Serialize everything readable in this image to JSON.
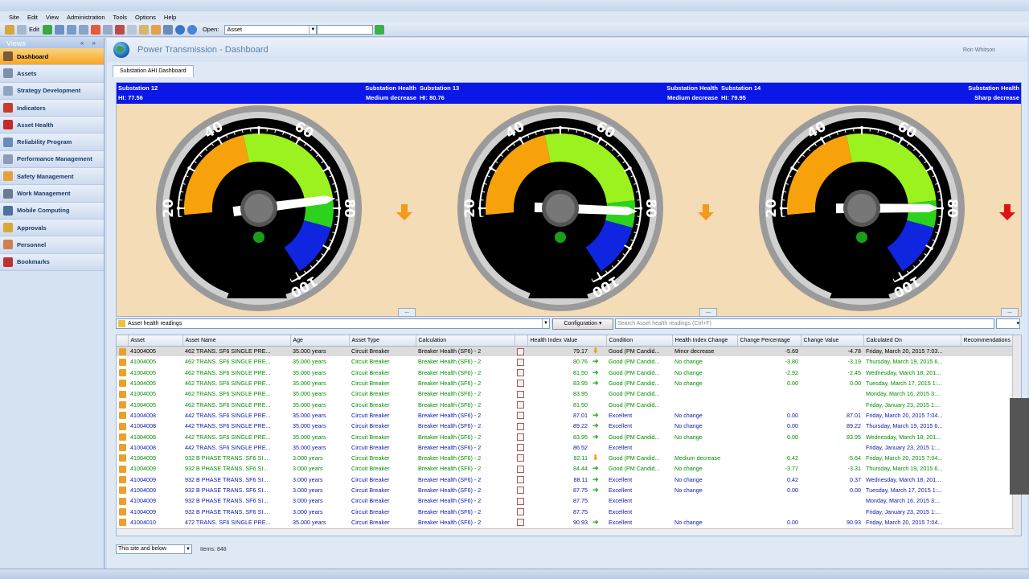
{
  "menu": [
    "Site",
    "Edit",
    "View",
    "Administration",
    "Tools",
    "Options",
    "Help"
  ],
  "toolbar": {
    "edit_label": "Edit",
    "open_label": "Open:",
    "open_value": "Asset"
  },
  "sidebar": {
    "header": "Views",
    "controls": "« »",
    "items": [
      {
        "label": "Dashboard",
        "icon": "dashboard-icon",
        "color": "#7a5a3a"
      },
      {
        "label": "Assets",
        "icon": "assets-icon",
        "color": "#7c8fa8"
      },
      {
        "label": "Strategy Development",
        "icon": "strategy-icon",
        "color": "#8ea6c4"
      },
      {
        "label": "Indicators",
        "icon": "indicators-icon",
        "color": "#c83b2a"
      },
      {
        "label": "Asset Health",
        "icon": "asset-health-icon",
        "color": "#c42a2a"
      },
      {
        "label": "Reliability Program",
        "icon": "reliability-icon",
        "color": "#6a8bb8"
      },
      {
        "label": "Performance Management",
        "icon": "performance-icon",
        "color": "#8a9cb6"
      },
      {
        "label": "Safety Management",
        "icon": "safety-icon",
        "color": "#e8a13a"
      },
      {
        "label": "Work Management",
        "icon": "work-icon",
        "color": "#6c7c90"
      },
      {
        "label": "Mobile Computing",
        "icon": "mobile-icon",
        "color": "#4f6f9f"
      },
      {
        "label": "Approvals",
        "icon": "approvals-icon",
        "color": "#d8a83a"
      },
      {
        "label": "Personnel",
        "icon": "personnel-icon",
        "color": "#d08050"
      },
      {
        "label": "Bookmarks",
        "icon": "bookmarks-icon",
        "color": "#c03030"
      }
    ]
  },
  "header": {
    "title": "Power Transmission - Dashboard",
    "user": "Ron Whitson"
  },
  "tab": {
    "label": "Substation AHI Dashboard"
  },
  "gauges": [
    {
      "name": "Substation 12",
      "hi": "HI: 77.56",
      "status_label": "Substation Health",
      "status": "Medium decrease",
      "value": 77.56,
      "trend_color": "#f29a1c",
      "trend": "down"
    },
    {
      "name": "Substation 13",
      "hi": "HI: 80.76",
      "status_label": "Substation Health",
      "status": "Medium decrease",
      "value": 80.76,
      "trend_color": "#f29a1c",
      "trend": "down"
    },
    {
      "name": "Substation 14",
      "hi": "HI: 79.95",
      "status_label": "Substation Health",
      "status": "Sharp decrease",
      "value": 79.95,
      "trend_color": "#e0101a",
      "trend": "down"
    }
  ],
  "gauge_ticks": [
    "20",
    "40",
    "60",
    "80",
    "100"
  ],
  "ellipsis": "...",
  "grid_toolbar": {
    "source": "Asset health readings",
    "config": "Configuration",
    "search_placeholder": "Search Asset health readings  (Ctrl+F)"
  },
  "columns": [
    "Asset",
    "Asset Name",
    "Age",
    "Asset Type",
    "Calculation",
    "",
    "Health Index Value",
    "Condition",
    "Health Index Change",
    "Change Percentage",
    "Change Value",
    "Calculated On",
    "Recommendations"
  ],
  "rows": [
    {
      "style": "selected",
      "asset": "41004005",
      "name": "462 TRANS. SF6 SINGLE PRE...",
      "age": "35.000 years",
      "type": "Circuit Breaker",
      "calc": "Breaker Health (SF6) - 2",
      "hiv": "79.17",
      "trend": "down-orange",
      "cond": "Good (PM Candid...",
      "change": "Minor decrease",
      "pct": "-5.69",
      "val": "-4.78",
      "on": "Friday, March 20, 2015 7:03..."
    },
    {
      "style": "g",
      "asset": "41004005",
      "name": "462 TRANS. SF6 SINGLE PRE...",
      "age": "35.000 years",
      "type": "Circuit Breaker",
      "calc": "Breaker Health (SF6) - 2",
      "hiv": "80.76",
      "trend": "right",
      "cond": "Good (PM Candid...",
      "change": "No change",
      "pct": "-3.80",
      "val": "-3.19",
      "on": "Thursday, March 19, 2015 6..."
    },
    {
      "style": "g",
      "asset": "41004005",
      "name": "462 TRANS. SF6 SINGLE PRE...",
      "age": "35.000 years",
      "type": "Circuit Breaker",
      "calc": "Breaker Health (SF6) - 2",
      "hiv": "81.50",
      "trend": "right",
      "cond": "Good (PM Candid...",
      "change": "No change",
      "pct": "-2.92",
      "val": "-2.45",
      "on": "Wednesday, March 18, 201..."
    },
    {
      "style": "g",
      "asset": "41004005",
      "name": "462 TRANS. SF6 SINGLE PRE...",
      "age": "35.000 years",
      "type": "Circuit Breaker",
      "calc": "Breaker Health (SF6) - 2",
      "hiv": "83.95",
      "trend": "right",
      "cond": "Good (PM Candid...",
      "change": "No change",
      "pct": "0.00",
      "val": "0.00",
      "on": "Tuesday, March 17, 2015 1:..."
    },
    {
      "style": "g",
      "asset": "41004005",
      "name": "462 TRANS. SF6 SINGLE PRE...",
      "age": "35.000 years",
      "type": "Circuit Breaker",
      "calc": "Breaker Health (SF6) - 2",
      "hiv": "83.95",
      "trend": "",
      "cond": "Good (PM Candid...",
      "change": "",
      "pct": "",
      "val": "",
      "on": "Monday, March 16, 2015 3:..."
    },
    {
      "style": "g",
      "asset": "41004005",
      "name": "462 TRANS. SF6 SINGLE PRE...",
      "age": "35.000 years",
      "type": "Circuit Breaker",
      "calc": "Breaker Health (SF6) - 2",
      "hiv": "81.50",
      "trend": "",
      "cond": "Good (PM Candid...",
      "change": "",
      "pct": "",
      "val": "",
      "on": "Friday, January 23, 2015 1:..."
    },
    {
      "style": "b",
      "asset": "41004008",
      "name": "442 TRANS. SF6 SINGLE PRE...",
      "age": "35.000 years",
      "type": "Circuit Breaker",
      "calc": "Breaker Health (SF6) - 2",
      "hiv": "87.01",
      "trend": "right",
      "cond": "Excellent",
      "change": "No change",
      "pct": "0.00",
      "val": "87.01",
      "on": "Friday, March 20, 2015 7:04..."
    },
    {
      "style": "b",
      "asset": "41004008",
      "name": "442 TRANS. SF6 SINGLE PRE...",
      "age": "35.000 years",
      "type": "Circuit Breaker",
      "calc": "Breaker Health (SF6) - 2",
      "hiv": "89.22",
      "trend": "right",
      "cond": "Excellent",
      "change": "No change",
      "pct": "0.00",
      "val": "89.22",
      "on": "Thursday, March 19, 2015 6..."
    },
    {
      "style": "g",
      "asset": "41004008",
      "name": "442 TRANS. SF6 SINGLE PRE...",
      "age": "35.000 years",
      "type": "Circuit Breaker",
      "calc": "Breaker Health (SF6) - 2",
      "hiv": "83.95",
      "trend": "right",
      "cond": "Good (PM Candid...",
      "change": "No change",
      "pct": "0.00",
      "val": "83.95",
      "on": "Wednesday, March 18, 201..."
    },
    {
      "style": "b",
      "asset": "41004008",
      "name": "442 TRANS. SF6 SINGLE PRE...",
      "age": "35.000 years",
      "type": "Circuit Breaker",
      "calc": "Breaker Health (SF6) - 2",
      "hiv": "86.52",
      "trend": "",
      "cond": "Excellent",
      "change": "",
      "pct": "",
      "val": "",
      "on": "Friday, January 23, 2015 1:..."
    },
    {
      "style": "g",
      "asset": "41004009",
      "name": "932  B PHASE TRANS. SF6 SI...",
      "age": "3.000 years",
      "type": "Circuit Breaker",
      "calc": "Breaker Health (SF6) - 2",
      "hiv": "82.11",
      "trend": "down-orange",
      "cond": "Good (PM Candid...",
      "change": "Medium decrease",
      "pct": "-6.42",
      "val": "-5.64",
      "on": "Friday, March 20, 2015 7:04..."
    },
    {
      "style": "g",
      "asset": "41004009",
      "name": "932  B PHASE TRANS. SF6 SI...",
      "age": "3.000 years",
      "type": "Circuit Breaker",
      "calc": "Breaker Health (SF6) - 2",
      "hiv": "84.44",
      "trend": "right",
      "cond": "Good (PM Candid...",
      "change": "No change",
      "pct": "-3.77",
      "val": "-3.31",
      "on": "Thursday, March 19, 2015 6..."
    },
    {
      "style": "b",
      "asset": "41004009",
      "name": "932  B PHASE TRANS. SF6 SI...",
      "age": "3.000 years",
      "type": "Circuit Breaker",
      "calc": "Breaker Health (SF6) - 2",
      "hiv": "88.11",
      "trend": "right",
      "cond": "Excellent",
      "change": "No change",
      "pct": "0.42",
      "val": "0.37",
      "on": "Wednesday, March 18, 201..."
    },
    {
      "style": "b",
      "asset": "41004009",
      "name": "932  B PHASE TRANS. SF6 SI...",
      "age": "3.000 years",
      "type": "Circuit Breaker",
      "calc": "Breaker Health (SF6) - 2",
      "hiv": "87.75",
      "trend": "right",
      "cond": "Excellent",
      "change": "No change",
      "pct": "0.00",
      "val": "0.00",
      "on": "Tuesday, March 17, 2015 1:..."
    },
    {
      "style": "b",
      "asset": "41004009",
      "name": "932  B PHASE TRANS. SF6 SI...",
      "age": "3.000 years",
      "type": "Circuit Breaker",
      "calc": "Breaker Health (SF6) - 2",
      "hiv": "87.75",
      "trend": "",
      "cond": "Excellent",
      "change": "",
      "pct": "",
      "val": "",
      "on": "Monday, March 16, 2015 3:..."
    },
    {
      "style": "b",
      "asset": "41004009",
      "name": "932  B PHASE TRANS. SF6 SI...",
      "age": "3.000 years",
      "type": "Circuit Breaker",
      "calc": "Breaker Health (SF6) - 2",
      "hiv": "87.75",
      "trend": "",
      "cond": "Excellent",
      "change": "",
      "pct": "",
      "val": "",
      "on": "Friday, January 23, 2015 1:..."
    },
    {
      "style": "b",
      "asset": "41004010",
      "name": "472 TRANS. SF6 SINGLE PRE...",
      "age": "35.000 years",
      "type": "Circuit Breaker",
      "calc": "Breaker Health (SF6) - 2",
      "hiv": "90.93",
      "trend": "right",
      "cond": "Excellent",
      "change": "No change",
      "pct": "0.00",
      "val": "90.93",
      "on": "Friday, March 20, 2015 7:04..."
    }
  ],
  "footer": {
    "scope": "This site and below",
    "items": "Items: 848"
  },
  "colors": {
    "bluebar": "#0b17e6",
    "panel": "#f3dcb6",
    "green_text": "#009000",
    "blue_text": "#0a1aa8",
    "dial_orange": "#f7a20b",
    "dial_green": "#9bf21e",
    "dial_blue": "#1025e0"
  }
}
